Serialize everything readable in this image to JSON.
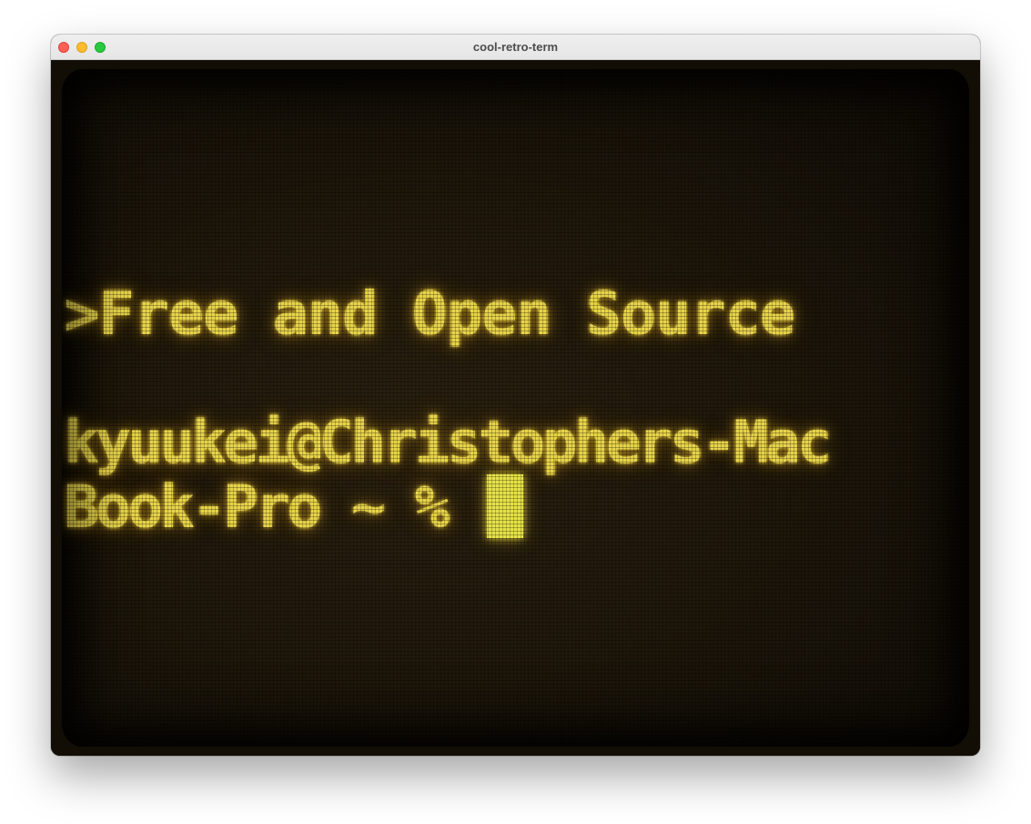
{
  "window": {
    "title": "cool-retro-term"
  },
  "terminal": {
    "lines": [
      ">Free and Open Source",
      "kyuukei@Christophers-Mac",
      "Book-Pro ~ % "
    ]
  },
  "colors": {
    "phosphor": "#e8d44a",
    "background": "#1a1208",
    "titlebar": "#ececec"
  }
}
